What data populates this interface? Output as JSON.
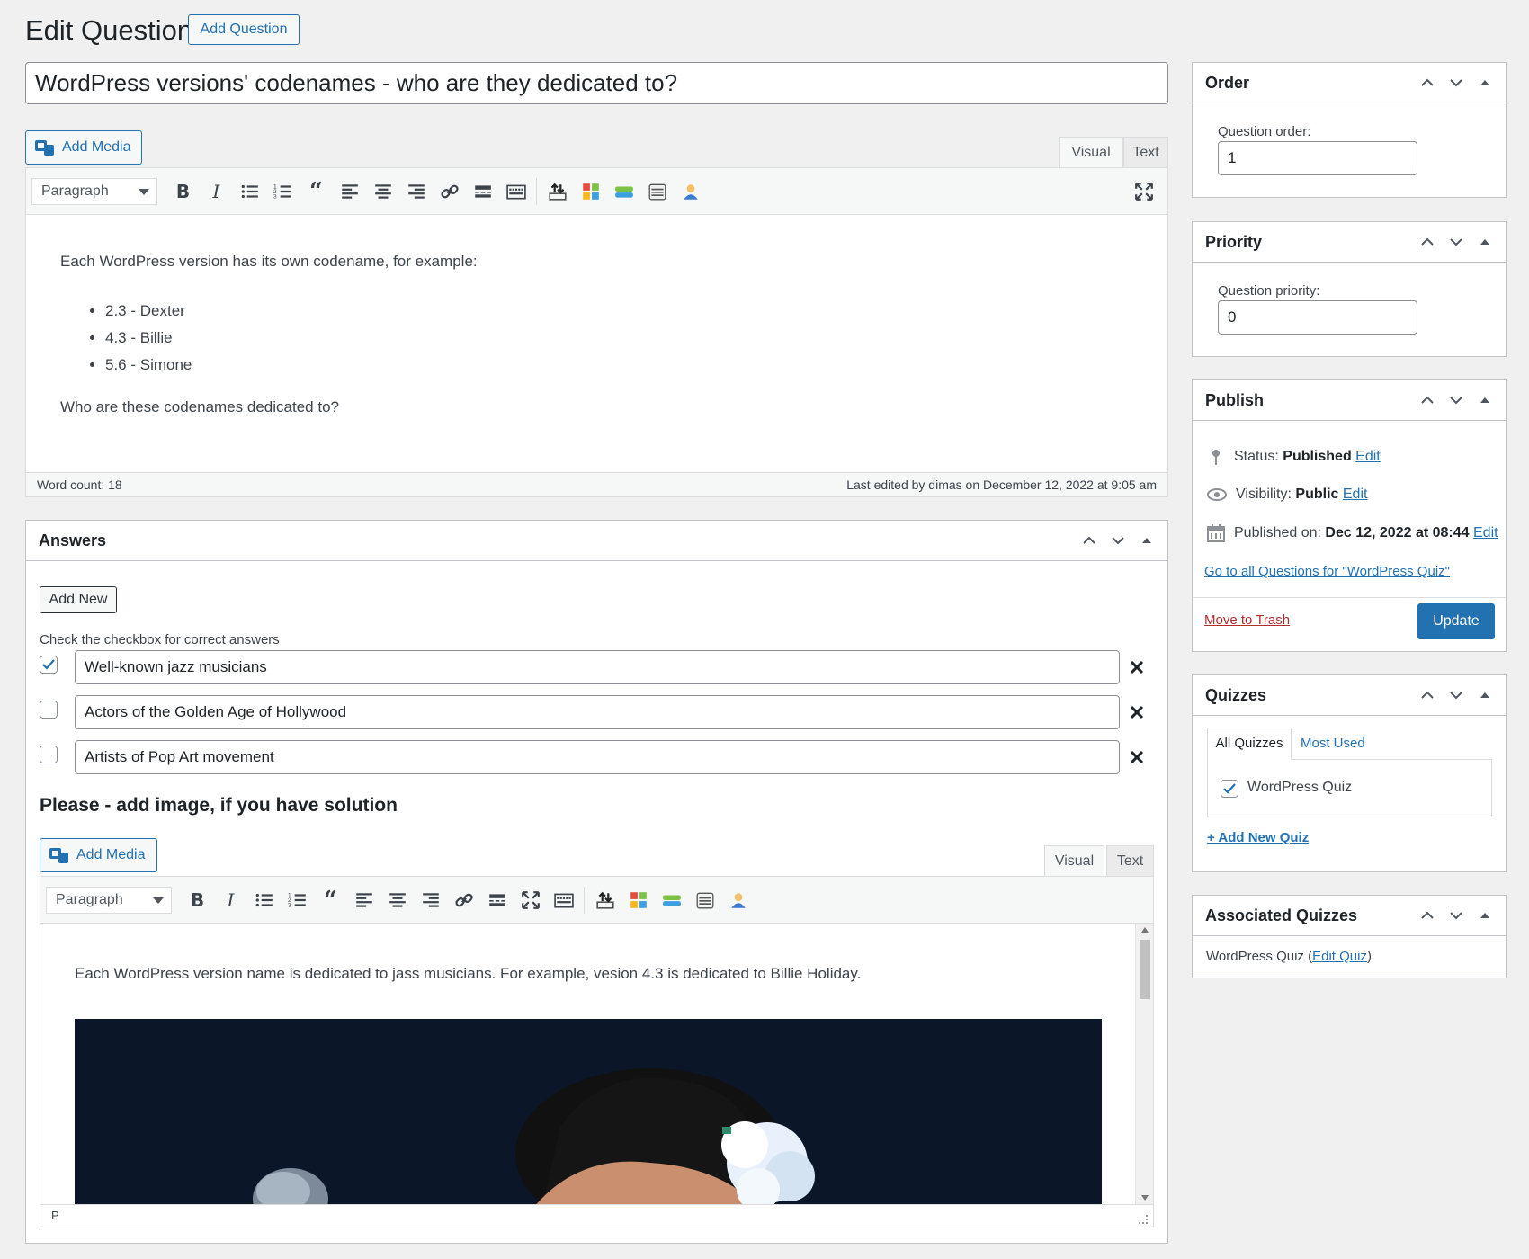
{
  "header": {
    "title": "Edit Question",
    "add_button": "Add Question"
  },
  "question": {
    "title_value": "WordPress versions' codenames - who are they dedicated to?",
    "add_media_label": "Add Media",
    "tabs": {
      "visual": "Visual",
      "text": "Text"
    },
    "format_select": "Paragraph",
    "content": {
      "intro": "Each WordPress version has its own codename, for example:",
      "items": [
        "2.3 - Dexter",
        "4.3 - Billie",
        "5.6 - Simone"
      ],
      "outro": "Who are these codenames dedicated to?"
    },
    "word_count": "Word count: 18",
    "last_edited": "Last edited by dimas on December 12, 2022 at 9:05 am"
  },
  "answers": {
    "title": "Answers",
    "add_new_label": "Add New",
    "hint": "Check the checkbox for correct answers",
    "items": [
      {
        "text": "Well-known jazz musicians",
        "checked": true
      },
      {
        "text": "Actors of the Golden Age of Hollywood",
        "checked": false
      },
      {
        "text": "Artists of Pop Art movement",
        "checked": false
      }
    ],
    "solution_heading": "Please - add image, if you have solution",
    "add_media_label": "Add Media",
    "tabs": {
      "visual": "Visual",
      "text": "Text"
    },
    "format_select": "Paragraph",
    "solution_text": "Each WordPress version name is dedicated to jass musicians. For example, vesion 4.3 is dedicated to Billie Holiday.",
    "path": "P"
  },
  "sidebar": {
    "order": {
      "title": "Order",
      "label": "Question order:",
      "value": "1"
    },
    "priority": {
      "title": "Priority",
      "label": "Question priority:",
      "value": "0"
    },
    "publish": {
      "title": "Publish",
      "status_label": "Status:",
      "status_value": "Published",
      "visibility_label": "Visibility:",
      "visibility_value": "Public",
      "published_label": "Published on:",
      "published_value": "Dec 12, 2022 at 08:44",
      "edit": "Edit",
      "all_questions_link": "Go to all Questions for \"WordPress Quiz\"",
      "trash_link": "Move to Trash",
      "update_label": "Update"
    },
    "quizzes": {
      "title": "Quizzes",
      "tab_all": "All Quizzes",
      "tab_most_used": "Most Used",
      "quiz_name": "WordPress Quiz",
      "add_new_link": "+ Add New Quiz"
    },
    "associated": {
      "title": "Associated Quizzes",
      "quiz_name": "WordPress Quiz",
      "open_paren": "(",
      "edit_link": "Edit Quiz",
      "close_paren": ")"
    }
  },
  "colors": {
    "accent": "#2271b1",
    "trash": "#b32d2e",
    "background": "#f0f0f1"
  }
}
